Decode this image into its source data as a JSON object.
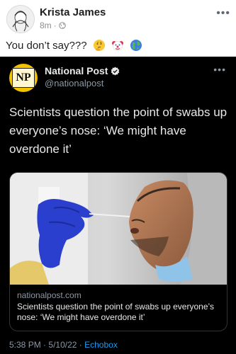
{
  "post": {
    "author_name": "Krista James",
    "time": "8m",
    "separator": "·",
    "text": "You don’t say???",
    "emojis": [
      "thinking-face-icon",
      "clown-face-icon",
      "globe-icon"
    ]
  },
  "tweet": {
    "logo_text": "NP",
    "name": "National Post",
    "handle": "@nationalpost",
    "more": "•••",
    "body": "Scientists question the point of swabs up everyone’s nose: ‘We might have overdone it’",
    "card": {
      "domain": "nationalpost.com",
      "title": "Scientists question the point of swabs up everyone’s nose: ‘We might have overdone it’"
    },
    "footer": {
      "time": "5:38 PM",
      "dot": "·",
      "date": "5/10/22",
      "source": "Echobox"
    }
  },
  "colors": {
    "tweet_bg": "#000000",
    "link_blue": "#1d9bf0",
    "np_yellow": "#f3c300",
    "glove_blue": "#2b3fcf"
  }
}
